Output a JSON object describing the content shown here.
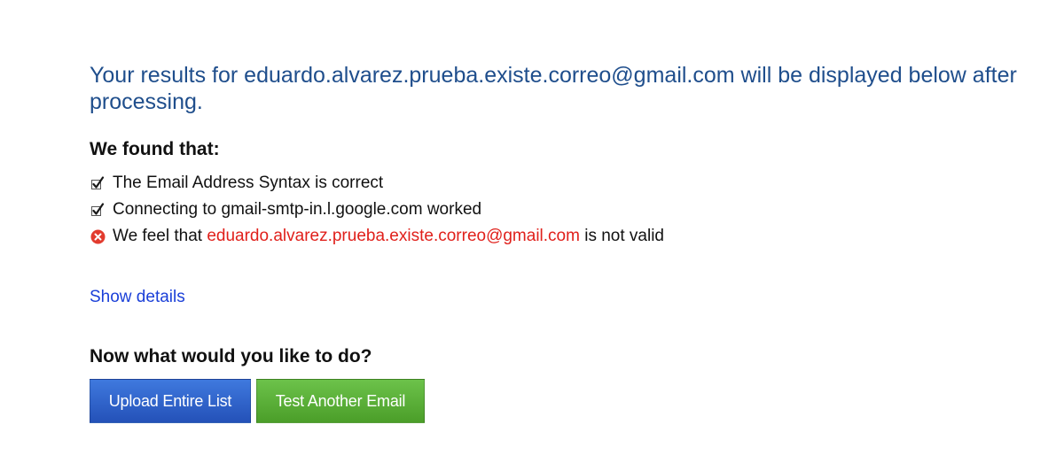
{
  "headline": {
    "prefix": "Your results for ",
    "email": "eduardo.alvarez.prueba.existe.correo@gmail.com",
    "suffix": " will be displayed below after processing."
  },
  "found": {
    "title": "We found that:",
    "items": [
      {
        "icon": "checkmark-icon",
        "text": "The Email Address Syntax is correct"
      },
      {
        "icon": "checkmark-icon",
        "text": "Connecting to gmail-smtp-in.l.google.com worked"
      },
      {
        "icon": "error-icon",
        "prefix": "We feel that ",
        "email": "eduardo.alvarez.prueba.existe.correo@gmail.com",
        "suffix": " is not valid"
      }
    ]
  },
  "details_link": "Show details",
  "next": {
    "title": "Now what would you like to do?",
    "upload_label": "Upload Entire List",
    "test_label": "Test Another Email"
  },
  "colors": {
    "headline": "#1f4e8c",
    "error": "#e0201b",
    "link": "#1a3fd8",
    "upload_button": "#2f64cc",
    "test_button": "#5cb03a"
  }
}
